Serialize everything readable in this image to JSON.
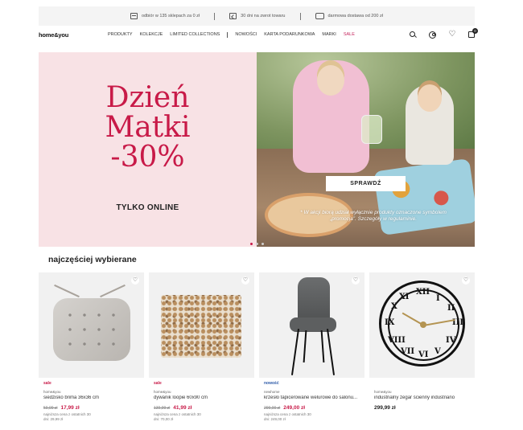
{
  "topbar": {
    "items": [
      {
        "icon": "store-icon",
        "text": "odbiór w 135 sklepach za 0 zł"
      },
      {
        "icon": "return-icon",
        "text": "30 dni na zwrot towaru"
      },
      {
        "icon": "truck-icon",
        "text": "darmowa dostawa od 200 zł"
      }
    ]
  },
  "header": {
    "logo": "home&you",
    "menu": [
      "PRODUKTY",
      "KOLEKCJE",
      "LIMITED COLLECTIONS",
      "NOWOŚCI",
      "KARTA PODARUNKOWA",
      "MARKI",
      "SALE"
    ],
    "icons": [
      "search-icon",
      "user-icon",
      "heart-icon",
      "bag-icon"
    ],
    "cart_count": "0"
  },
  "hero": {
    "title_line1": "Dzień",
    "title_line2": "Matki",
    "title_line3": "-30%",
    "subtitle": "TYLKO ONLINE",
    "cta": "SPRAWDŹ",
    "disclaimer": "* W akcji biorą udział wyłącznie produkty oznaczone symbolem „promocja”. Szczegóły w regulaminie.",
    "colors": {
      "title": "#c81a48",
      "background": "#f8e2e5"
    },
    "slides": 3,
    "active_slide": 1
  },
  "section": {
    "title": "najczęściej wybierane"
  },
  "products": [
    {
      "tag": "sale",
      "brand": "home&you",
      "name": "siedzisko brima 36x36 cm",
      "old_price": "59,99 zł",
      "price": "17,99 zł",
      "lowest_label": "najniższa cena z ostatnich 30",
      "lowest_value": "dni: 29,99 zł"
    },
    {
      "tag": "sale",
      "brand": "home&you",
      "name": "dywanik loopie 60x90 cm",
      "old_price": "139,99 zł",
      "price": "41,99 zł",
      "lowest_label": "najniższa cena z ostatnich 30",
      "lowest_value": "dni: 70,00 zł"
    },
    {
      "tag": "nowość",
      "brand": "newhome",
      "name": "krzesło tapicerowane welurowe do salonu...",
      "old_price": "299,00 zł",
      "price": "249,00 zł",
      "lowest_label": "najniższa cena z ostatnich 30",
      "lowest_value": "dni: 249,00 zł"
    },
    {
      "tag": "",
      "brand": "home&you",
      "name": "industrialny zegar ścienny industriano",
      "old_price": "",
      "price": "299,99 zł",
      "lowest_label": "",
      "lowest_value": ""
    }
  ]
}
